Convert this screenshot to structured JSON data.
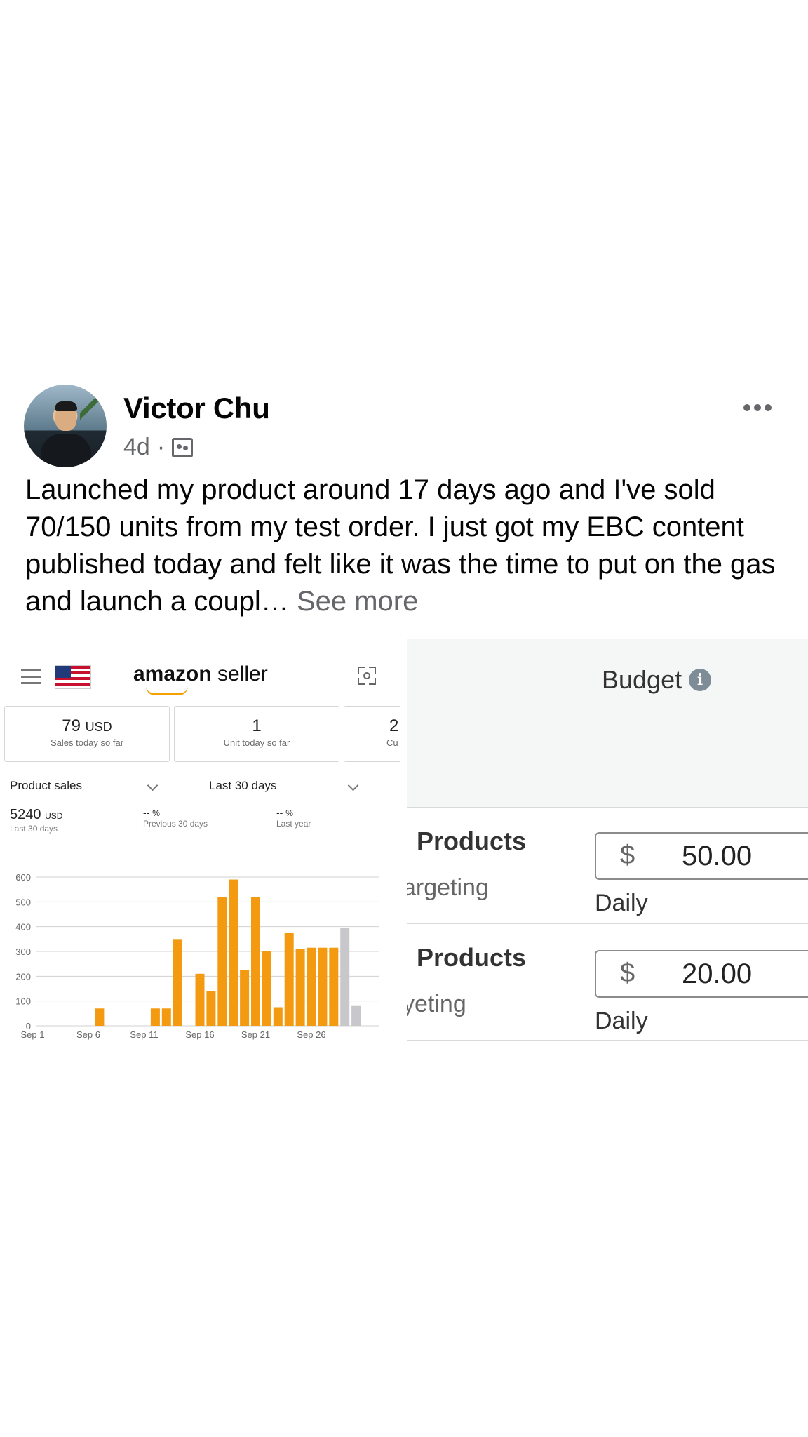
{
  "post": {
    "author": "Victor Chu",
    "age": "4d",
    "separator": "·",
    "audience_icon": "group-icon",
    "caption": "Launched my product around 17 days ago and I've sold 70/150 units from my test order. I just got my EBC content published today and felt like it was the time to put on the gas and launch a coupl…",
    "see_more": "See more"
  },
  "amazon": {
    "logo_bold": "amazon",
    "logo_rest": " seller",
    "cards": [
      {
        "value": "79",
        "unit": "USD",
        "label": "Sales today so far"
      },
      {
        "value": "1",
        "unit": "",
        "label": "Unit today so far"
      },
      {
        "value": "2",
        "unit": "",
        "label": "Cu"
      }
    ],
    "metric_select": "Product sales",
    "range_select": "Last 30 days",
    "metrics": [
      {
        "value": "5240",
        "unit": "USD",
        "label": "Last 30 days"
      },
      {
        "value": "--",
        "unit": "%",
        "label": "Previous 30 days"
      },
      {
        "value": "--",
        "unit": "%",
        "label": "Last year"
      }
    ]
  },
  "chart_data": {
    "type": "bar",
    "title": "",
    "xlabel": "",
    "ylabel": "",
    "ylim": [
      0,
      600
    ],
    "yticks": [
      0,
      100,
      200,
      300,
      400,
      500,
      600
    ],
    "xtick_labels": [
      "Sep 1",
      "Sep 6",
      "Sep 11",
      "Sep 16",
      "Sep 21",
      "Sep 26"
    ],
    "grid": true,
    "categories": [
      "Sep 1",
      "Sep 2",
      "Sep 3",
      "Sep 4",
      "Sep 5",
      "Sep 6",
      "Sep 7",
      "Sep 8",
      "Sep 9",
      "Sep 10",
      "Sep 11",
      "Sep 12",
      "Sep 13",
      "Sep 14",
      "Sep 15",
      "Sep 16",
      "Sep 17",
      "Sep 18",
      "Sep 19",
      "Sep 20",
      "Sep 21",
      "Sep 22",
      "Sep 23",
      "Sep 24",
      "Sep 25",
      "Sep 26",
      "Sep 27",
      "Sep 28",
      "Sep 29",
      "Sep 30"
    ],
    "values": [
      0,
      0,
      0,
      0,
      0,
      0,
      70,
      0,
      0,
      0,
      0,
      70,
      70,
      350,
      0,
      210,
      140,
      520,
      590,
      225,
      520,
      300,
      75,
      375,
      310,
      315,
      315,
      315,
      395,
      80
    ],
    "colors": [
      "#f39a10",
      "#f39a10",
      "#f39a10",
      "#f39a10",
      "#f39a10",
      "#f39a10",
      "#f39a10",
      "#f39a10",
      "#f39a10",
      "#f39a10",
      "#f39a10",
      "#f39a10",
      "#f39a10",
      "#f39a10",
      "#f39a10",
      "#f39a10",
      "#f39a10",
      "#f39a10",
      "#f39a10",
      "#f39a10",
      "#f39a10",
      "#f39a10",
      "#f39a10",
      "#f39a10",
      "#f39a10",
      "#f39a10",
      "#f39a10",
      "#f39a10",
      "#c8c8cc",
      "#c8c8cc"
    ]
  },
  "campaign": {
    "budget_header": "Budget",
    "rows": [
      {
        "title": "Products",
        "subtitle": "argeting",
        "currency": "$",
        "amount": "50.00",
        "period": "Daily"
      },
      {
        "title": "Products",
        "subtitle": "yeting",
        "currency": "$",
        "amount": "20.00",
        "period": "Daily"
      }
    ]
  }
}
